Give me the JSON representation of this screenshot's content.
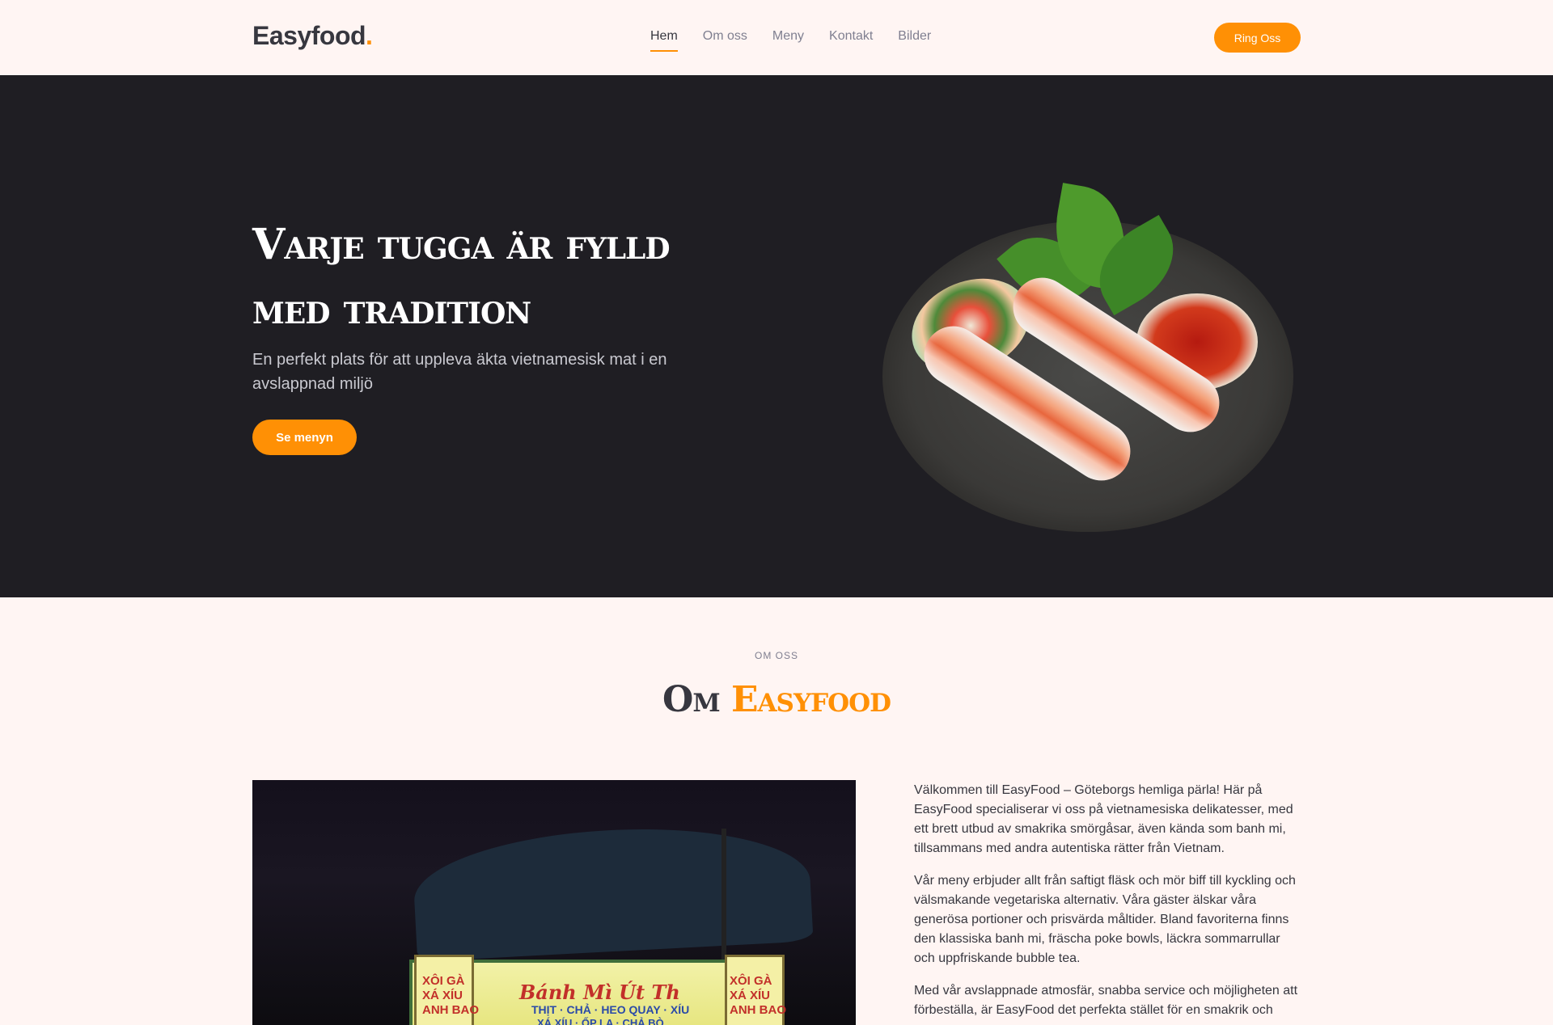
{
  "header": {
    "logo": "Easyfood",
    "logo_dot": ".",
    "nav": [
      "Hem",
      "Om oss",
      "Meny",
      "Kontakt",
      "Bilder"
    ],
    "active_nav": "Hem",
    "call_button": "Ring Oss"
  },
  "hero": {
    "title": "Varje tugga är fylld med tradition",
    "subtitle": "En perfekt plats för att uppleva äkta vietnamesisk mat i en avslappnad miljö",
    "button": "Se menyn"
  },
  "about": {
    "eyebrow": "OM OSS",
    "title_prefix": "Om ",
    "title_accent": "Easyfood",
    "photo_sign": {
      "title": "Bánh Mì Út Th",
      "subtitle": "THỊT · CHẢ · HEO QUAY · XÍU",
      "subtitle2": "XÁ XÍU · ỐP LA · CHẢ BÒ",
      "side_left": [
        "XÔI GÀ",
        "XÁ XÍU",
        "ANH BAO"
      ],
      "side_right": [
        "XÔI GÀ",
        "XÁ XÍU",
        "ANH BAO"
      ]
    },
    "paragraphs": [
      "Välkommen till EasyFood – Göteborgs hemliga pärla! Här på EasyFood specialiserar vi oss på vietnamesiska delikatesser, med ett brett utbud av smakrika smörgåsar, även kända som banh mi, tillsammans med andra autentiska rätter från Vietnam.",
      "Vår meny erbjuder allt från saftigt fläsk och mör biff till kyckling och välsmakande vegetariska alternativ. Våra gäster älskar våra generösa portioner och prisvärda måltider. Bland favoriterna finns den klassiska banh mi, fräscha poke bowls, läckra sommarrullar och uppfriskande bubble tea.",
      "Med vår avslappnade atmosfär, snabba service och möjligheten att förbeställa, är EasyFood det perfekta stället för en smakrik och"
    ]
  },
  "colors": {
    "accent": "#ff9005",
    "hero_bg": "#1f1e23",
    "page_bg": "#fff5f3"
  }
}
